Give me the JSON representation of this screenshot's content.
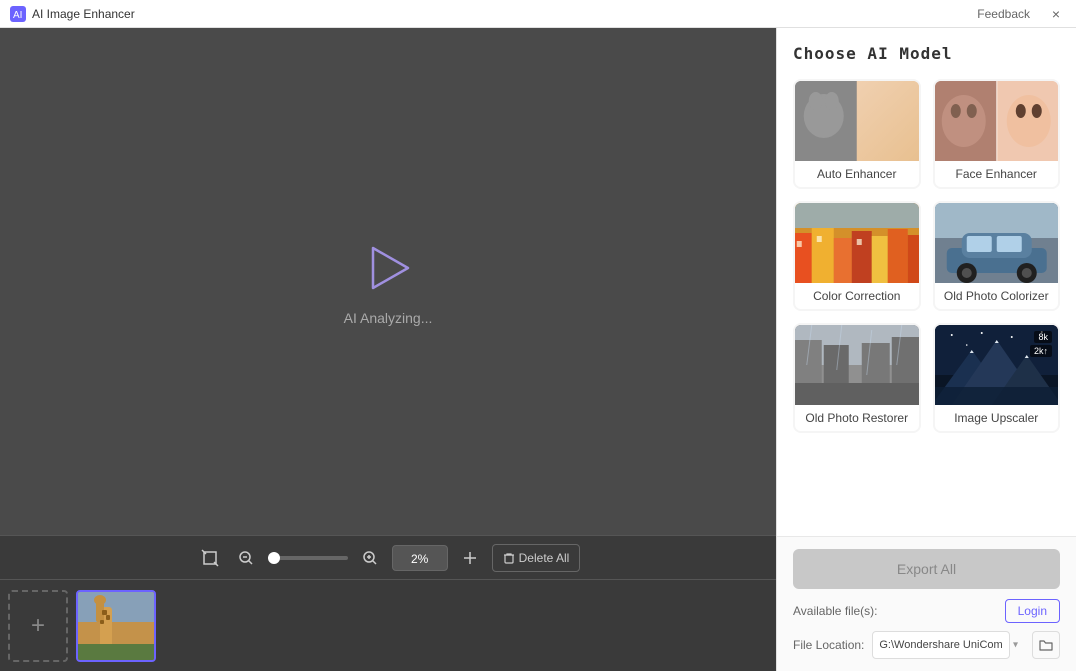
{
  "app": {
    "title": "AI Image Enhancer",
    "feedback_label": "Feedback",
    "close_label": "×"
  },
  "canvas": {
    "analyzing_text": "AI Analyzing...",
    "zoom_value": "2%"
  },
  "toolbar": {
    "delete_all_label": "Delete All",
    "zoom_value": "2%"
  },
  "right_panel": {
    "title": "Choose AI Model",
    "models": [
      {
        "id": "auto-enhancer",
        "label": "Auto Enhancer",
        "thumb_class": "thumb-auto-enhancer"
      },
      {
        "id": "face-enhancer",
        "label": "Face Enhancer",
        "thumb_class": "thumb-face-enhancer"
      },
      {
        "id": "color-correction",
        "label": "Color Correction",
        "thumb_class": "thumb-color-correction"
      },
      {
        "id": "old-photo-colorizer",
        "label": "Old Photo Colorizer",
        "thumb_class": "thumb-old-photo-colorizer"
      },
      {
        "id": "old-photo-restorer",
        "label": "Old Photo Restorer",
        "thumb_class": "thumb-old-photo-restorer"
      },
      {
        "id": "image-upscaler",
        "label": "Image Upscaler",
        "thumb_class": "thumb-image-upscaler"
      }
    ],
    "export_all_label": "Export All",
    "available_files_label": "Available file(s):",
    "login_label": "Login",
    "file_location_label": "File Location:",
    "file_location_value": "G:\\Wondershare UniCom",
    "folder_icon": "📁"
  }
}
